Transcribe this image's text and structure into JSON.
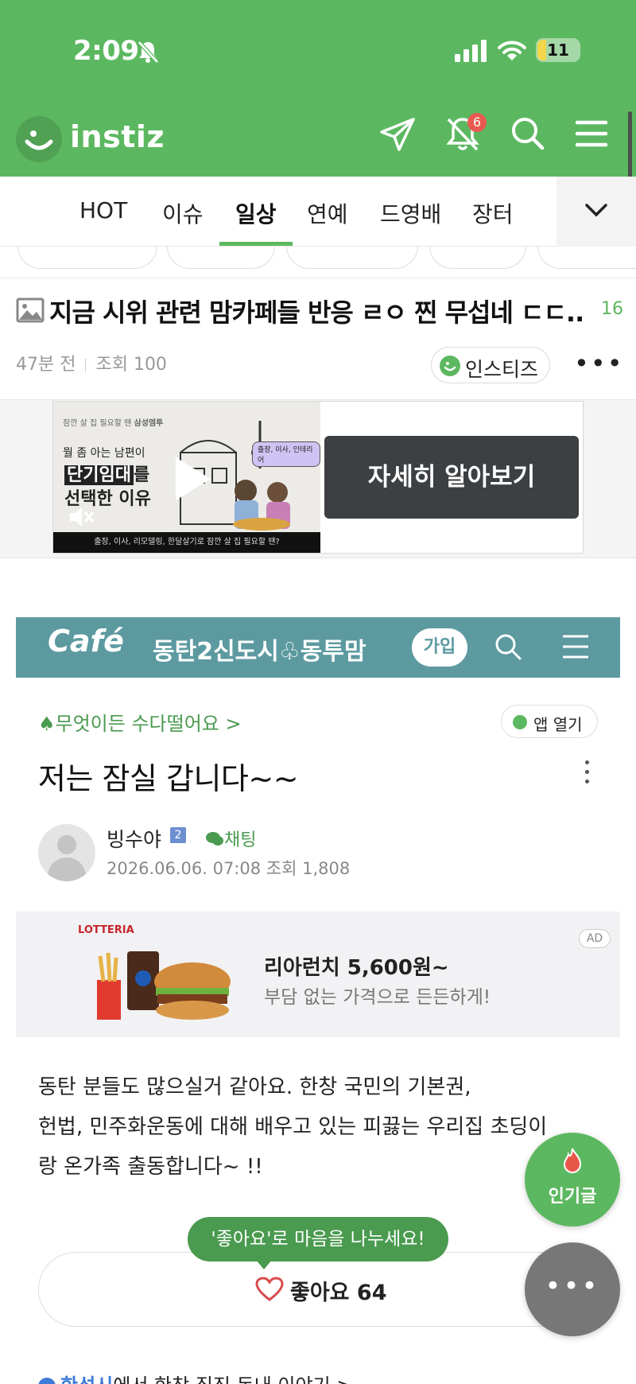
{
  "status": {
    "time": "2:09",
    "battery": "11",
    "battery_fraction": 0.11
  },
  "header": {
    "logo": "instiz",
    "notification_count": "6",
    "icons": [
      "send-icon",
      "bell-off-icon",
      "search-icon",
      "menu-icon"
    ],
    "brand_color": "#5cb860"
  },
  "tabs": [
    {
      "label": "HOT",
      "active": false
    },
    {
      "label": "이슈",
      "active": false
    },
    {
      "label": "일상",
      "active": true
    },
    {
      "label": "연예",
      "active": false
    },
    {
      "label": "드영배",
      "active": false
    },
    {
      "label": "장터",
      "active": false
    }
  ],
  "post": {
    "title": "지금 시위 관련 맘카페들 반응 ㄹㅇ 찐 무섭네 ㄷㄷ..",
    "comment_count": "16",
    "time_ago": "47분 전",
    "views": "조회 100",
    "author": "인스티즈"
  },
  "ad": {
    "brand": "삼성엠투",
    "brand_prefix": "잠깐 살 집 필요할 땐",
    "headline": "뭘 좀 아는 남편이",
    "big_line1_highlight": "단기임대",
    "big_line1_rest": "를",
    "big_line2": "선택한 이유",
    "tag": "출장, 이사, 인테리어",
    "caption": "출장, 이사, 리모델링, 한달살기로 잠깐 살 집 필요할 땐?",
    "cta": "자세히 알아보기"
  },
  "cafe": {
    "logo": "Café",
    "name": "동탄2신도시♧동투맘",
    "join": "가입",
    "board": "♠무엇이든 수다떨어요 >",
    "app_open": "앱 열기",
    "title": "저는 잠실 갑니다~~",
    "nickname": "빙수야",
    "level": "2",
    "chat": "채팅",
    "date": "2026.06.06. 07:08  조회 1,808",
    "accent_color": "#5c9aa0",
    "ad": {
      "brand": "LOTTERIA",
      "headline": "리아런치 5,600원~",
      "sub": "부담 없는 가격으로 든든하게!",
      "label": "AD"
    },
    "body_lines": [
      "동탄 분들도 많으실거 같아요. 한창 국민의 기본권,",
      "헌법, 민주화운동에 대해 배우고 있는 피끓는 우리집 초딩이",
      "랑 온가족 출동합니다~ !!"
    ],
    "tooltip": "'좋아요'로 마음을 나누세요!",
    "like_label": "좋아요 64",
    "next_peek_bold": "한성시",
    "next_peek_rest": "에서 한창 집짓 돈내 이야기 >"
  },
  "fab": {
    "popular": "인기글",
    "more": "•••"
  }
}
